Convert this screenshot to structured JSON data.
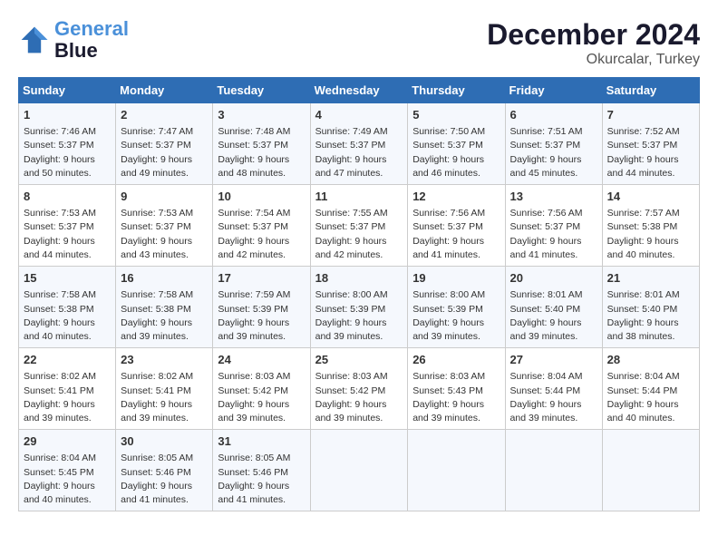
{
  "logo": {
    "line1": "General",
    "line2": "Blue"
  },
  "title": "December 2024",
  "location": "Okurcalar, Turkey",
  "headers": [
    "Sunday",
    "Monday",
    "Tuesday",
    "Wednesday",
    "Thursday",
    "Friday",
    "Saturday"
  ],
  "weeks": [
    [
      {
        "day": "1",
        "sunrise": "Sunrise: 7:46 AM",
        "sunset": "Sunset: 5:37 PM",
        "daylight": "Daylight: 9 hours and 50 minutes."
      },
      {
        "day": "2",
        "sunrise": "Sunrise: 7:47 AM",
        "sunset": "Sunset: 5:37 PM",
        "daylight": "Daylight: 9 hours and 49 minutes."
      },
      {
        "day": "3",
        "sunrise": "Sunrise: 7:48 AM",
        "sunset": "Sunset: 5:37 PM",
        "daylight": "Daylight: 9 hours and 48 minutes."
      },
      {
        "day": "4",
        "sunrise": "Sunrise: 7:49 AM",
        "sunset": "Sunset: 5:37 PM",
        "daylight": "Daylight: 9 hours and 47 minutes."
      },
      {
        "day": "5",
        "sunrise": "Sunrise: 7:50 AM",
        "sunset": "Sunset: 5:37 PM",
        "daylight": "Daylight: 9 hours and 46 minutes."
      },
      {
        "day": "6",
        "sunrise": "Sunrise: 7:51 AM",
        "sunset": "Sunset: 5:37 PM",
        "daylight": "Daylight: 9 hours and 45 minutes."
      },
      {
        "day": "7",
        "sunrise": "Sunrise: 7:52 AM",
        "sunset": "Sunset: 5:37 PM",
        "daylight": "Daylight: 9 hours and 44 minutes."
      }
    ],
    [
      {
        "day": "8",
        "sunrise": "Sunrise: 7:53 AM",
        "sunset": "Sunset: 5:37 PM",
        "daylight": "Daylight: 9 hours and 44 minutes."
      },
      {
        "day": "9",
        "sunrise": "Sunrise: 7:53 AM",
        "sunset": "Sunset: 5:37 PM",
        "daylight": "Daylight: 9 hours and 43 minutes."
      },
      {
        "day": "10",
        "sunrise": "Sunrise: 7:54 AM",
        "sunset": "Sunset: 5:37 PM",
        "daylight": "Daylight: 9 hours and 42 minutes."
      },
      {
        "day": "11",
        "sunrise": "Sunrise: 7:55 AM",
        "sunset": "Sunset: 5:37 PM",
        "daylight": "Daylight: 9 hours and 42 minutes."
      },
      {
        "day": "12",
        "sunrise": "Sunrise: 7:56 AM",
        "sunset": "Sunset: 5:37 PM",
        "daylight": "Daylight: 9 hours and 41 minutes."
      },
      {
        "day": "13",
        "sunrise": "Sunrise: 7:56 AM",
        "sunset": "Sunset: 5:37 PM",
        "daylight": "Daylight: 9 hours and 41 minutes."
      },
      {
        "day": "14",
        "sunrise": "Sunrise: 7:57 AM",
        "sunset": "Sunset: 5:38 PM",
        "daylight": "Daylight: 9 hours and 40 minutes."
      }
    ],
    [
      {
        "day": "15",
        "sunrise": "Sunrise: 7:58 AM",
        "sunset": "Sunset: 5:38 PM",
        "daylight": "Daylight: 9 hours and 40 minutes."
      },
      {
        "day": "16",
        "sunrise": "Sunrise: 7:58 AM",
        "sunset": "Sunset: 5:38 PM",
        "daylight": "Daylight: 9 hours and 39 minutes."
      },
      {
        "day": "17",
        "sunrise": "Sunrise: 7:59 AM",
        "sunset": "Sunset: 5:39 PM",
        "daylight": "Daylight: 9 hours and 39 minutes."
      },
      {
        "day": "18",
        "sunrise": "Sunrise: 8:00 AM",
        "sunset": "Sunset: 5:39 PM",
        "daylight": "Daylight: 9 hours and 39 minutes."
      },
      {
        "day": "19",
        "sunrise": "Sunrise: 8:00 AM",
        "sunset": "Sunset: 5:39 PM",
        "daylight": "Daylight: 9 hours and 39 minutes."
      },
      {
        "day": "20",
        "sunrise": "Sunrise: 8:01 AM",
        "sunset": "Sunset: 5:40 PM",
        "daylight": "Daylight: 9 hours and 39 minutes."
      },
      {
        "day": "21",
        "sunrise": "Sunrise: 8:01 AM",
        "sunset": "Sunset: 5:40 PM",
        "daylight": "Daylight: 9 hours and 38 minutes."
      }
    ],
    [
      {
        "day": "22",
        "sunrise": "Sunrise: 8:02 AM",
        "sunset": "Sunset: 5:41 PM",
        "daylight": "Daylight: 9 hours and 39 minutes."
      },
      {
        "day": "23",
        "sunrise": "Sunrise: 8:02 AM",
        "sunset": "Sunset: 5:41 PM",
        "daylight": "Daylight: 9 hours and 39 minutes."
      },
      {
        "day": "24",
        "sunrise": "Sunrise: 8:03 AM",
        "sunset": "Sunset: 5:42 PM",
        "daylight": "Daylight: 9 hours and 39 minutes."
      },
      {
        "day": "25",
        "sunrise": "Sunrise: 8:03 AM",
        "sunset": "Sunset: 5:42 PM",
        "daylight": "Daylight: 9 hours and 39 minutes."
      },
      {
        "day": "26",
        "sunrise": "Sunrise: 8:03 AM",
        "sunset": "Sunset: 5:43 PM",
        "daylight": "Daylight: 9 hours and 39 minutes."
      },
      {
        "day": "27",
        "sunrise": "Sunrise: 8:04 AM",
        "sunset": "Sunset: 5:44 PM",
        "daylight": "Daylight: 9 hours and 39 minutes."
      },
      {
        "day": "28",
        "sunrise": "Sunrise: 8:04 AM",
        "sunset": "Sunset: 5:44 PM",
        "daylight": "Daylight: 9 hours and 40 minutes."
      }
    ],
    [
      {
        "day": "29",
        "sunrise": "Sunrise: 8:04 AM",
        "sunset": "Sunset: 5:45 PM",
        "daylight": "Daylight: 9 hours and 40 minutes."
      },
      {
        "day": "30",
        "sunrise": "Sunrise: 8:05 AM",
        "sunset": "Sunset: 5:46 PM",
        "daylight": "Daylight: 9 hours and 41 minutes."
      },
      {
        "day": "31",
        "sunrise": "Sunrise: 8:05 AM",
        "sunset": "Sunset: 5:46 PM",
        "daylight": "Daylight: 9 hours and 41 minutes."
      },
      null,
      null,
      null,
      null
    ]
  ]
}
